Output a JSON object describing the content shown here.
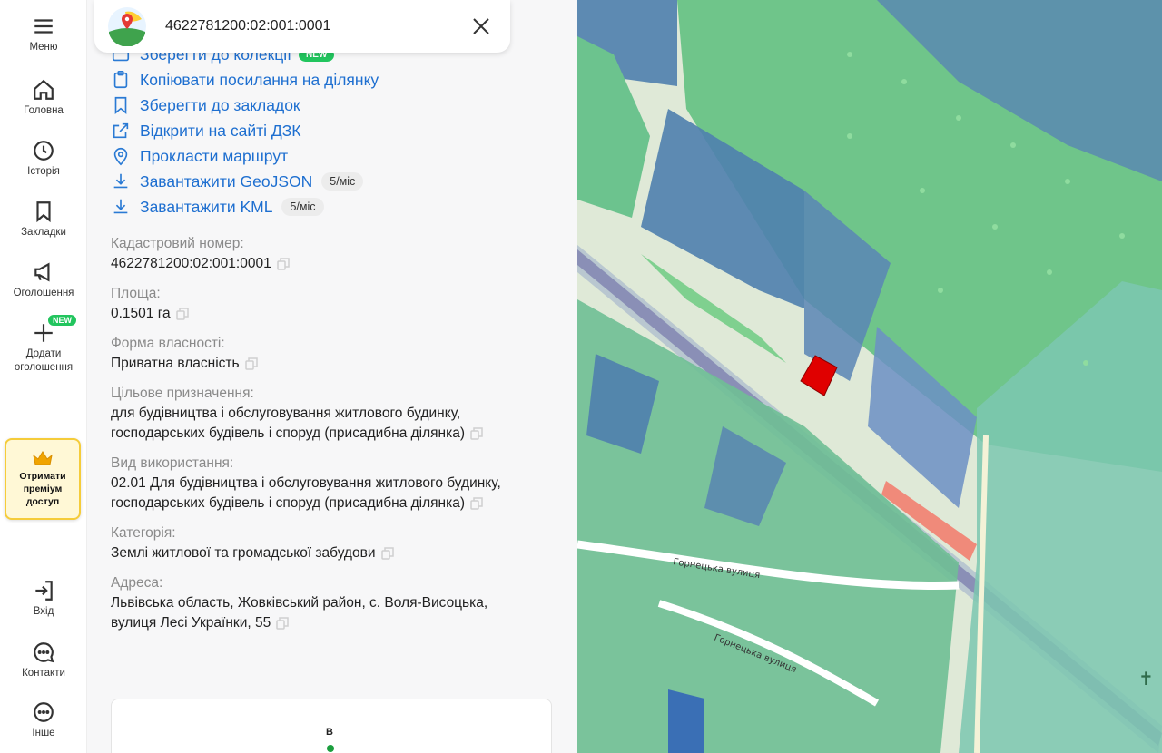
{
  "rail": {
    "menu": "Меню",
    "home": "Головна",
    "history": "Історія",
    "bookmarks": "Закладки",
    "ads": "Оголошення",
    "add_ad_line1": "Додати",
    "add_ad_line2": "оголошення",
    "new_badge": "NEW",
    "premium_line1": "Отримати",
    "premium_line2": "преміум",
    "premium_line3": "доступ",
    "login": "Вхід",
    "contacts": "Контакти",
    "other": "Інше"
  },
  "search": {
    "value": "4622781200:02:001:0001"
  },
  "actions": [
    {
      "label": "Зберегти до колекції",
      "badge": "NEW"
    },
    {
      "label": "Копіювати посилання на ділянку"
    },
    {
      "label": "Зберегти до закладок"
    },
    {
      "label": "Відкрити на сайті ДЗК"
    },
    {
      "label": "Прокласти маршрут"
    },
    {
      "label": "Завантажити GeoJSON",
      "limit": "5/міс"
    },
    {
      "label": "Завантажити KML",
      "limit": "5/міс"
    }
  ],
  "fields": {
    "cadastral": {
      "label": "Кадастровий номер:",
      "value": "4622781200:02:001:0001"
    },
    "area": {
      "label": "Площа:",
      "value": "0.1501 га"
    },
    "ownership": {
      "label": "Форма власності:",
      "value": "Приватна власність"
    },
    "purpose": {
      "label": "Цільове призначення:",
      "line1": "для будівництва і обслуговування житлового будинку,",
      "line2": "господарських будівель і споруд (присадибна ділянка)"
    },
    "usage": {
      "label": "Вид використання:",
      "line1": "02.01 Для будівництва і обслуговування житлового будинку,",
      "line2": "господарських будівель і споруд (присадибна ділянка)"
    },
    "category": {
      "label": "Категорія:",
      "value": "Землі житлової та громадської забудови"
    },
    "address": {
      "label": "Адреса:",
      "line1": "Львівська область, Жовківський район, с. Воля-Висоцька,",
      "line2": "вулиця Лесі Українки, 55"
    }
  },
  "minimap": {
    "compass": "В"
  },
  "map": {
    "street1": "Горнецька вулиця",
    "street2": "Горнецька вулиця",
    "colors": {
      "forest": "#72c98a",
      "parcel_blue": "#5b82b8",
      "parcel_green": "#5fbf8a",
      "selected": "#e00000",
      "road": "#ffffff"
    }
  }
}
